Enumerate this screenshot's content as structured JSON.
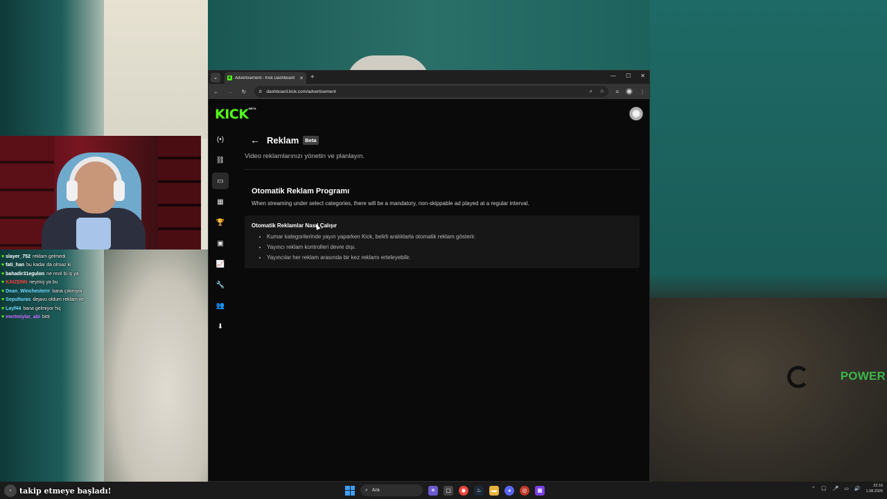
{
  "background": {
    "brand_text": "POWER"
  },
  "chat": [
    {
      "user": "slayer_752",
      "msg": "reklam gelmedi",
      "color": "#ffffff"
    },
    {
      "user": "fati_han",
      "msg": "bu kadar da olmaz ki",
      "color": "#ffffff"
    },
    {
      "user": "bahadir31egulon",
      "msg": "ne rezil bi iş ya",
      "color": "#ffffff"
    },
    {
      "user": "KAIZENN",
      "msg": "neymiş ya bu",
      "color": "#ff3b3b"
    },
    {
      "user": "Dean_Winchesterrr",
      "msg": "bana çıkmıyor",
      "color": "#6fd6ff"
    },
    {
      "user": "Sepulturas",
      "msg": "dejavu oldum reklam ile",
      "color": "#6fd6ff"
    },
    {
      "user": "Layf44",
      "msg": "bana gelmiyor hiç",
      "color": "#6fd6ff"
    },
    {
      "user": "mertmiylar_abi",
      "msg": "bitti",
      "color": "#c868ff"
    }
  ],
  "browser": {
    "tab_title": "Advertisement - Kick Dashboard",
    "url": "dashboard.kick.com/advertisement"
  },
  "kick": {
    "logo": "KICK",
    "logo_beta": "BETA"
  },
  "sidebar": [
    {
      "name": "sidebar-item-stream",
      "icon": "(•)"
    },
    {
      "name": "sidebar-item-links",
      "icon": "⛓"
    },
    {
      "name": "sidebar-item-advertisement",
      "icon": "▭",
      "active": true
    },
    {
      "name": "sidebar-item-analytics",
      "icon": "▦"
    },
    {
      "name": "sidebar-item-achievements",
      "icon": "🏆"
    },
    {
      "name": "sidebar-item-media",
      "icon": "▣"
    },
    {
      "name": "sidebar-item-stats",
      "icon": "📈"
    },
    {
      "name": "sidebar-item-tools",
      "icon": "🔧"
    },
    {
      "name": "sidebar-item-community",
      "icon": "👥"
    },
    {
      "name": "sidebar-item-download",
      "icon": "⬇"
    }
  ],
  "page": {
    "title": "Reklam",
    "beta": "Beta",
    "subtitle": "Video reklamlarınızı yönetin ve planlayın.",
    "section_title": "Otomatik Reklam Programı",
    "section_desc": "When streaming under select categories, there will be a mandatory, non-skippable ad played at a regular interval.",
    "info_title": "Otomatik Reklamlar Nasıl Çalışır",
    "info_items": [
      "Kumar kategorilerinde yayın yaparken Kick, belirli aralıklarla otomatik reklam gösterir.",
      "Yayıncı reklam kontrolleri devre dışı.",
      "Yayıncılar her reklam arasında bir kez reklamı erteleyebilir."
    ]
  },
  "taskbar": {
    "notification": "takip etmeye başladı!",
    "search": "Ara",
    "time": "22:16",
    "date": "1.08.2026"
  },
  "colors": {
    "kick_green": "#53fc18",
    "page_bg": "#0a0a0a"
  }
}
